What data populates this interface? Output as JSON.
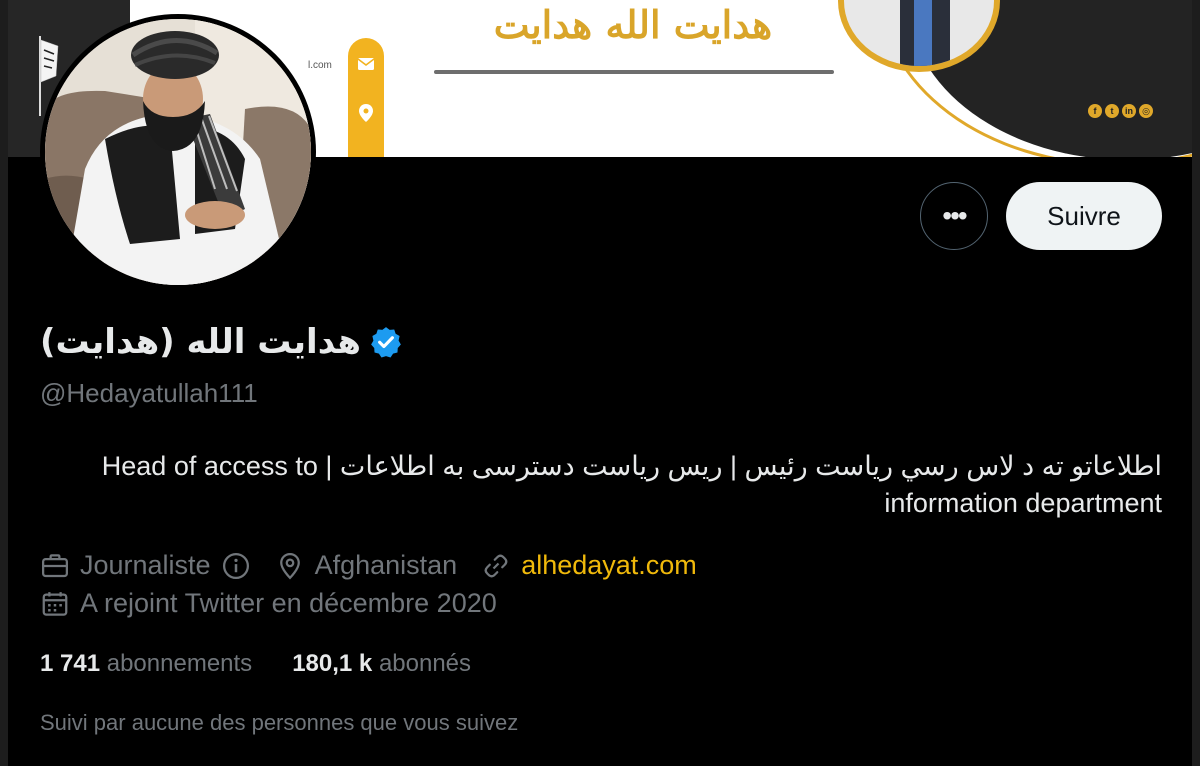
{
  "banner": {
    "title": "هدايت الله هدايت",
    "url_fragment": "l.com",
    "icons": [
      "mail-icon",
      "location-icon"
    ],
    "social_icons": [
      "facebook-icon",
      "twitter-icon",
      "linkedin-icon",
      "instagram-icon"
    ],
    "accent_color": "#e0a82a"
  },
  "profile": {
    "display_name": "هدايت الله (هدايت)",
    "verified": true,
    "handle": "@Hedayatullah111",
    "bio_line1": "اطلاعاتو ته د لاس رسي رياست رئيس | ریس ریاست دسترسی به اطلاعات | Head of access to",
    "bio_line2": "information department",
    "profession": "Journaliste",
    "location": "Afghanistan",
    "website": "alhedayat.com",
    "joined": "A rejoint Twitter en décembre 2020"
  },
  "actions": {
    "more_label": "•••",
    "follow_label": "Suivre"
  },
  "stats": {
    "following_count": "1 741",
    "following_label": "abonnements",
    "followers_count": "180,1 k",
    "followers_label": "abonnés"
  },
  "followed_by": "Suivi par aucune des personnes que vous suivez",
  "colors": {
    "background": "#000000",
    "text": "#e7e9ea",
    "muted": "#71767b",
    "link": "#f0b90b",
    "verified": "#1d9bf0"
  }
}
